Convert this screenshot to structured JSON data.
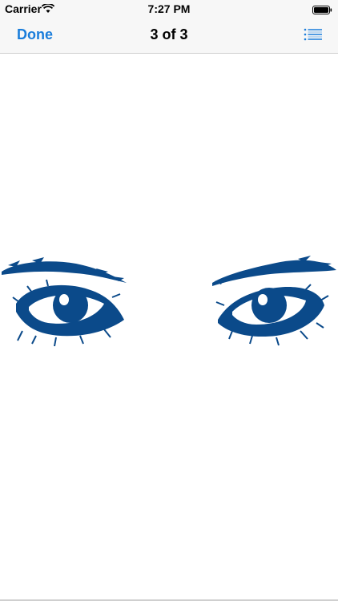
{
  "status_bar": {
    "carrier": "Carrier",
    "time": "7:27 PM",
    "wifi_icon": "wifi-icon",
    "battery_icon": "battery-icon"
  },
  "nav": {
    "done_label": "Done",
    "title": "3 of 3",
    "list_icon": "list-icon"
  },
  "content": {
    "image": "eyes-illustration"
  },
  "colors": {
    "accent": "#1a7ddb",
    "ink": "#0b4a8a",
    "bar": "#f7f7f7"
  }
}
